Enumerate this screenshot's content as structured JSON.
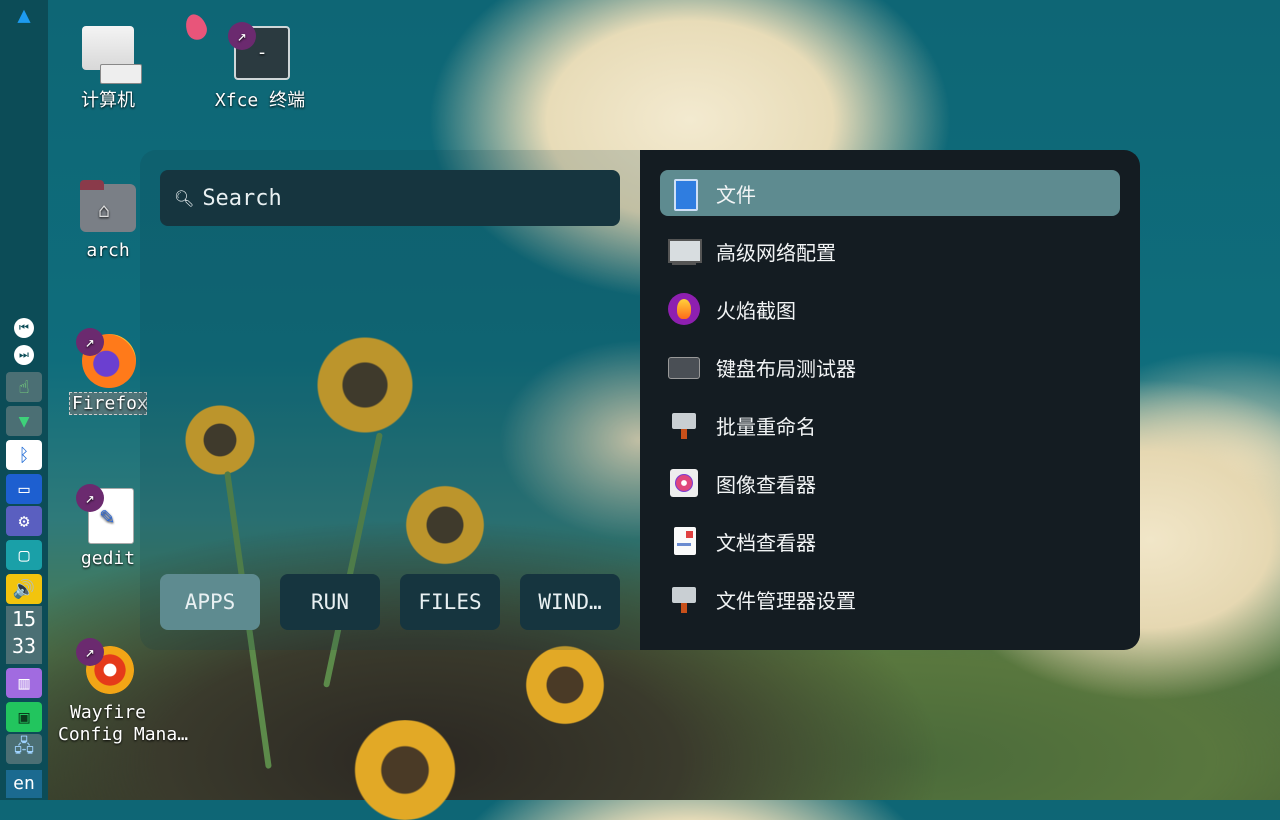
{
  "panel": {
    "clock_hour": "15",
    "clock_minute": "33",
    "language": "en",
    "items": [
      {
        "name": "media-prev-icon"
      },
      {
        "name": "media-next-icon"
      },
      {
        "name": "touch-icon"
      },
      {
        "name": "vpn-shield-icon"
      },
      {
        "name": "bluetooth-icon"
      },
      {
        "name": "display-off-icon"
      },
      {
        "name": "settings-gear-icon"
      },
      {
        "name": "screen-share-icon"
      },
      {
        "name": "volume-icon"
      }
    ]
  },
  "desktop": {
    "icons": [
      {
        "label": "计算机"
      },
      {
        "label": "Xfce 终端"
      },
      {
        "label": "arch"
      },
      {
        "label": "Firefox"
      },
      {
        "label": "gedit"
      },
      {
        "label": "Wayfire\nConfig Mana…"
      }
    ]
  },
  "launcher": {
    "search_placeholder": "Search",
    "tabs": [
      {
        "label": "APPS"
      },
      {
        "label": "RUN"
      },
      {
        "label": "FILES"
      },
      {
        "label": "WIND…"
      }
    ],
    "results": [
      {
        "label": "文件"
      },
      {
        "label": "高级网络配置"
      },
      {
        "label": "火焰截图"
      },
      {
        "label": "键盘布局测试器"
      },
      {
        "label": "批量重命名"
      },
      {
        "label": "图像查看器"
      },
      {
        "label": "文档查看器"
      },
      {
        "label": "文件管理器设置"
      }
    ]
  }
}
